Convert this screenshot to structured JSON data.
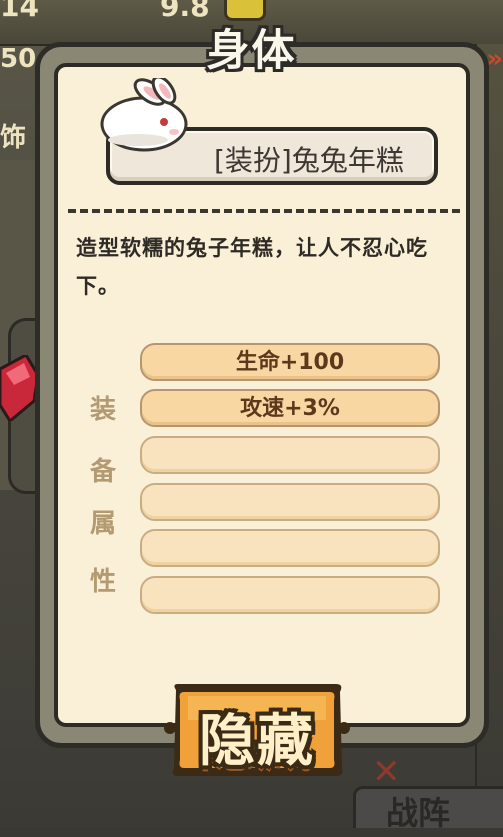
{
  "background": {
    "top_left_number": "14",
    "top_center_number": "9.8",
    "left_number": "50",
    "side_label": "饰",
    "bottom_right_label": "战阵"
  },
  "modal": {
    "title": "身体",
    "item_name": "[装扮]兔兔年糕",
    "item_icon": "rabbit-icon",
    "description": "造型软糯的兔子年糕，让人不忍心吃下。",
    "attribute_label_chars": [
      "装",
      "备",
      "属",
      "性"
    ],
    "attributes": [
      "生命+100",
      "攻速+3%",
      "",
      "",
      "",
      ""
    ],
    "hide_button_label": "隐藏"
  },
  "colors": {
    "panel_frame": "#8a8775",
    "paper": "#faf0d7",
    "attr_fill": "#f8d7a2",
    "attr_text": "#5d381d",
    "button_orange": "#f0a13a"
  }
}
